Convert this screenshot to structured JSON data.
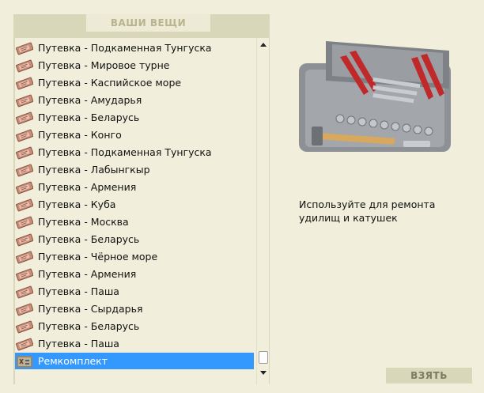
{
  "inventory": {
    "header": "ВАШИ ВЕЩИ",
    "items": [
      {
        "label": "Путевка - Подкаменная Тунгуска",
        "icon": "ticket-icon"
      },
      {
        "label": "Путевка - Мировое турне",
        "icon": "ticket-icon"
      },
      {
        "label": "Путевка - Каспийское море",
        "icon": "ticket-icon"
      },
      {
        "label": "Путевка - Амударья",
        "icon": "ticket-icon"
      },
      {
        "label": "Путевка - Беларусь",
        "icon": "ticket-icon"
      },
      {
        "label": "Путевка - Конго",
        "icon": "ticket-icon"
      },
      {
        "label": "Путевка - Подкаменная Тунгуска",
        "icon": "ticket-icon"
      },
      {
        "label": "Путевка - Лабынгкыр",
        "icon": "ticket-icon"
      },
      {
        "label": "Путевка - Армения",
        "icon": "ticket-icon"
      },
      {
        "label": "Путевка - Куба",
        "icon": "ticket-icon"
      },
      {
        "label": "Путевка - Москва",
        "icon": "ticket-icon"
      },
      {
        "label": "Путевка - Беларусь",
        "icon": "ticket-icon"
      },
      {
        "label": "Путевка - Чёрное море",
        "icon": "ticket-icon"
      },
      {
        "label": "Путевка - Армения",
        "icon": "ticket-icon"
      },
      {
        "label": "Путевка - Паша",
        "icon": "ticket-icon"
      },
      {
        "label": "Путевка - Сырдарья",
        "icon": "ticket-icon"
      },
      {
        "label": "Путевка - Беларусь",
        "icon": "ticket-icon"
      },
      {
        "label": "Путевка - Паша",
        "icon": "ticket-icon"
      },
      {
        "label": "Ремкомплект",
        "icon": "repair-kit-icon",
        "selected": true
      }
    ]
  },
  "detail": {
    "image": "toolbox-image",
    "description": "Используйте для ремонта удилищ и катушек"
  },
  "actions": {
    "take_label": "ВЗЯТЬ"
  },
  "colors": {
    "background": "#f1efdb",
    "panel": "#d9d7b9",
    "selection": "#3399ff"
  }
}
